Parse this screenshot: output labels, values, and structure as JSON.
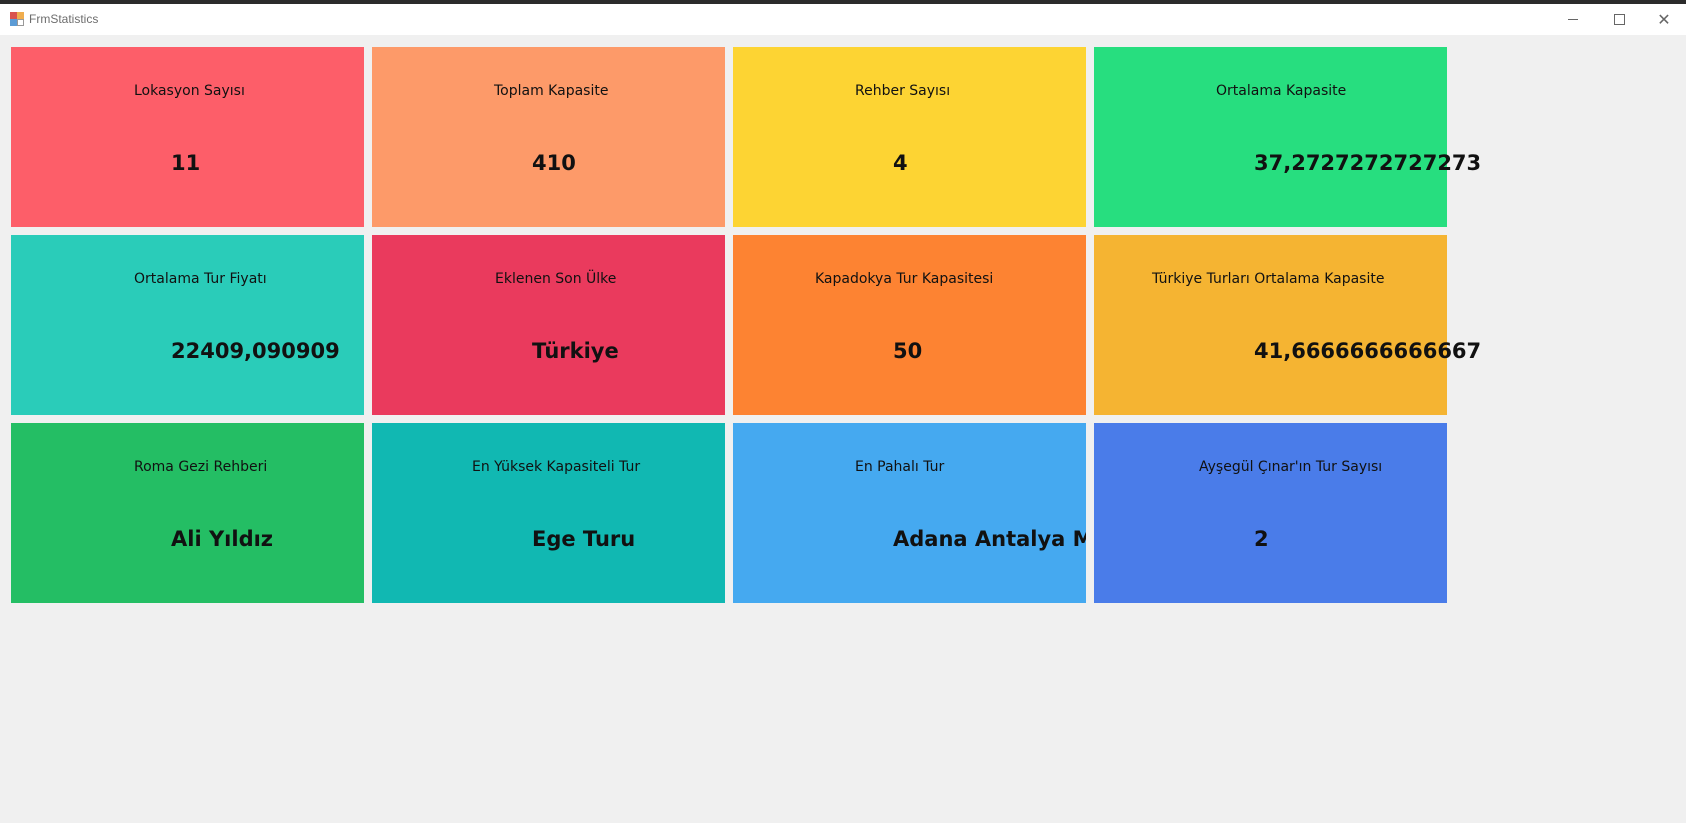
{
  "window": {
    "title": "FrmStatistics"
  },
  "tiles": [
    {
      "label": "Lokasyon Sayısı",
      "value": "11",
      "color": "#fd5e69"
    },
    {
      "label": "Toplam Kapasite",
      "value": "410",
      "color": "#fd9a69"
    },
    {
      "label": "Rehber Sayısı",
      "value": "4",
      "color": "#fdd433"
    },
    {
      "label": "Ortalama Kapasite",
      "value": "37,2727272727273",
      "color": "#27de7f"
    },
    {
      "label": "Ortalama Tur Fiyatı",
      "value": "22409,090909",
      "color": "#2accb9"
    },
    {
      "label": "Eklenen Son Ülke",
      "value": "Türkiye",
      "color": "#ea3a5d"
    },
    {
      "label": "Kapadokya Tur Kapasitesi",
      "value": "50",
      "color": "#fd8332"
    },
    {
      "label": "Türkiye Turları Ortalama Kapasite",
      "value": "41,6666666666667",
      "color": "#f5b432"
    },
    {
      "label": "Roma Gezi Rehberi",
      "value": "Ali Yıldız",
      "color": "#24be64"
    },
    {
      "label": "En Yüksek Kapasiteli Tur",
      "value": "Ege Turu",
      "color": "#11b8b2"
    },
    {
      "label": "En Pahalı Tur",
      "value": "Adana Antalya Mersin Turu",
      "color": "#45a9f0"
    },
    {
      "label": "Ayşegül Çınar'ın Tur Sayısı",
      "value": "2",
      "color": "#4a7ce9"
    }
  ]
}
